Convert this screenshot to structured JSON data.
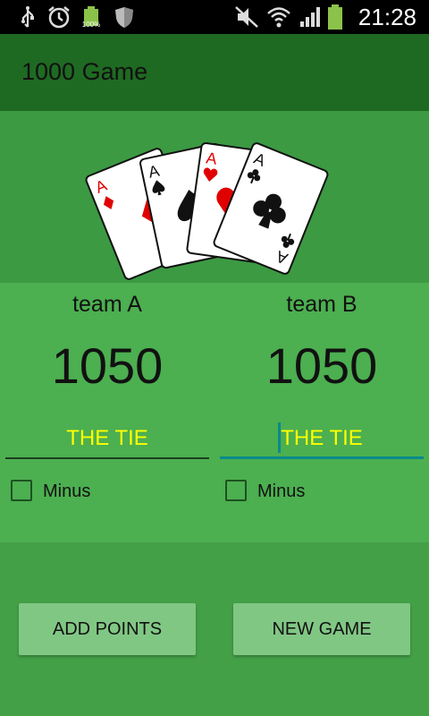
{
  "status_bar": {
    "time": "21:28",
    "battery_level": "100%",
    "icons": [
      "usb-icon",
      "alarm-icon",
      "battery-icon",
      "shield-icon",
      "mute-icon",
      "wifi-icon",
      "signal-icon",
      "battery-charging-icon"
    ]
  },
  "app_bar": {
    "title": "1000 Game"
  },
  "teams": [
    {
      "name": "team A",
      "score": "1050",
      "tie_text": "THE TIE",
      "minus_label": "Minus"
    },
    {
      "name": "team B",
      "score": "1050",
      "tie_text": "THE TIE",
      "minus_label": "Minus"
    }
  ],
  "buttons": {
    "add_points": "ADD POINTS",
    "new_game": "NEW GAME"
  },
  "cards": [
    {
      "rank": "A",
      "suit": "diamonds"
    },
    {
      "rank": "A",
      "suit": "spades"
    },
    {
      "rank": "A",
      "suit": "hearts"
    },
    {
      "rank": "A",
      "suit": "clubs"
    }
  ],
  "colors": {
    "accent": "#0a8a8a",
    "tie_text": "#ffff00",
    "app_bar": "#1f6a22",
    "panel": "#4caf50",
    "button": "#81c784"
  }
}
